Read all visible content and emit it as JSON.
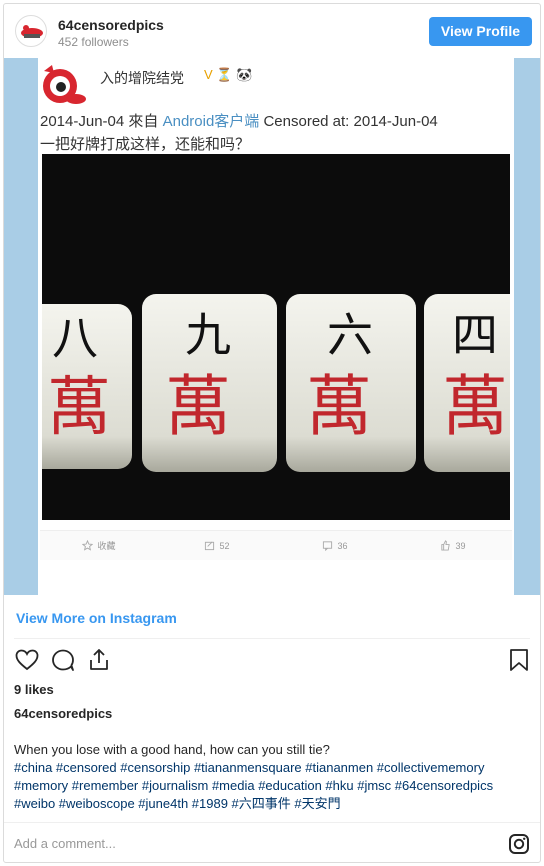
{
  "header": {
    "username": "64censoredpics",
    "followers": "452 followers",
    "view_profile_label": "View Profile"
  },
  "weibo": {
    "author": "入的增院结党",
    "badges": "V ⏳ 🐼",
    "date": "2014-Jun-04",
    "via": "來自",
    "source": "Android客户端",
    "censored_label": "Censored at: 2014-Jun-04",
    "text": "一把好牌打成这样，还能和吗？",
    "tiles": [
      "八",
      "九",
      "六",
      "四"
    ],
    "tile_second_char": "萬",
    "actions": [
      {
        "icon": "star-icon",
        "label": "收藏"
      },
      {
        "icon": "repost-icon",
        "label": "52"
      },
      {
        "icon": "comment-icon",
        "label": "36"
      },
      {
        "icon": "thumb-icon",
        "label": "39"
      }
    ]
  },
  "view_more_label": "View More on Instagram",
  "likes": "9 likes",
  "owner": "64censoredpics",
  "caption": "When you lose with a good hand, how can you still tie?",
  "hashtags": "#china #censored #censorship #tiananmensquare #tiananmen #collectivememory #memory #remember #journalism #media #education #hku #jmsc #64censoredpics #weibo #weiboscope #june4th #1989 #六四事件 #天安門",
  "comment_placeholder": "Add a comment...",
  "colors": {
    "accent": "#3897f0",
    "hashtag": "#003569",
    "media_bg": "#a9cde6",
    "weibo_link": "#4a8fc2"
  }
}
